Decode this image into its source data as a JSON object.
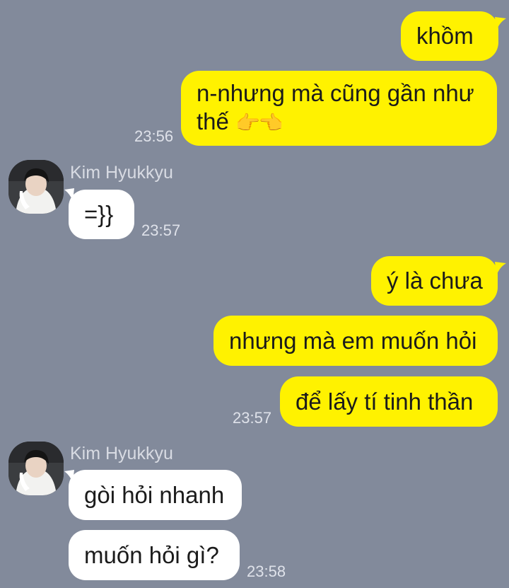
{
  "background_color": "#828a9b",
  "my_bubble_color": "#fff200",
  "their_bubble_color": "#ffffff",
  "contact_name": "Kim Hyukkyu",
  "messages": [
    {
      "sender": "me",
      "text": "khồm"
    },
    {
      "sender": "me",
      "text": "n-nhưng mà cũng gần như thế",
      "emoji": "👉👈",
      "time": "23:56"
    },
    {
      "sender": "Kim Hyukkyu",
      "text": "=}}",
      "time": "23:57"
    },
    {
      "sender": "me",
      "text": "ý là chưa"
    },
    {
      "sender": "me",
      "text": "nhưng mà em muốn hỏi"
    },
    {
      "sender": "me",
      "text": "để lấy tí tinh thần",
      "time": "23:57"
    },
    {
      "sender": "Kim Hyukkyu",
      "text": "gòi hỏi nhanh"
    },
    {
      "sender": "Kim Hyukkyu",
      "text": "muốn hỏi gì?",
      "time": "23:58"
    }
  ]
}
